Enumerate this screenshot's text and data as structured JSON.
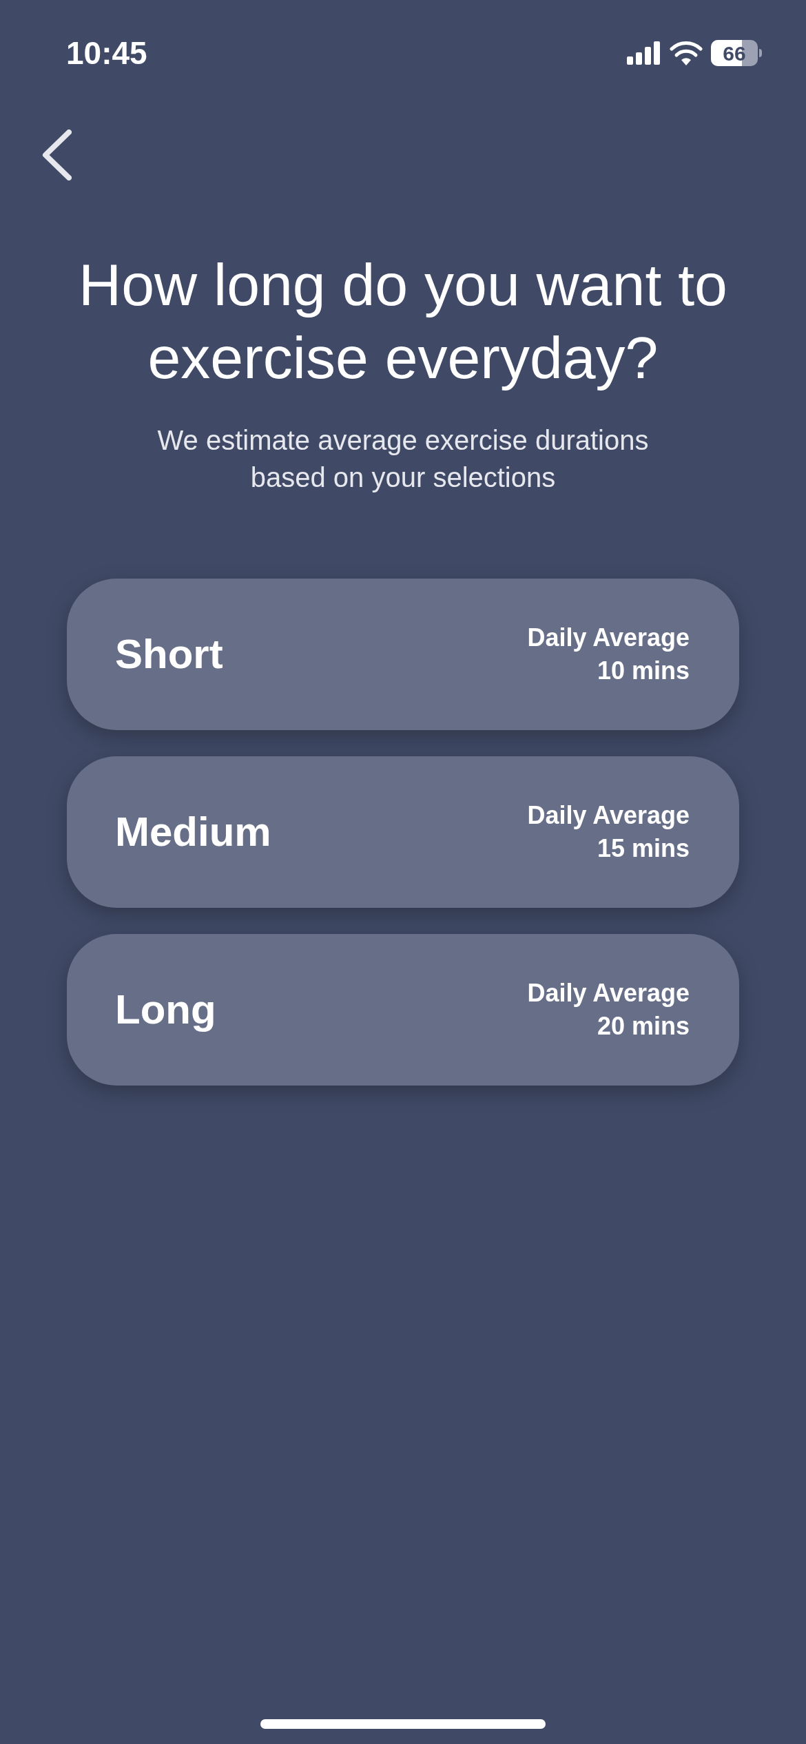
{
  "status_bar": {
    "time": "10:45",
    "battery": "66"
  },
  "title": "How long do you want to exercise everyday?",
  "subtitle": "We estimate average exercise durations based on your selections",
  "options": [
    {
      "label": "Short",
      "caption": "Daily Average",
      "value": "10 mins"
    },
    {
      "label": "Medium",
      "caption": "Daily Average",
      "value": "15 mins"
    },
    {
      "label": "Long",
      "caption": "Daily Average",
      "value": "20 mins"
    }
  ]
}
